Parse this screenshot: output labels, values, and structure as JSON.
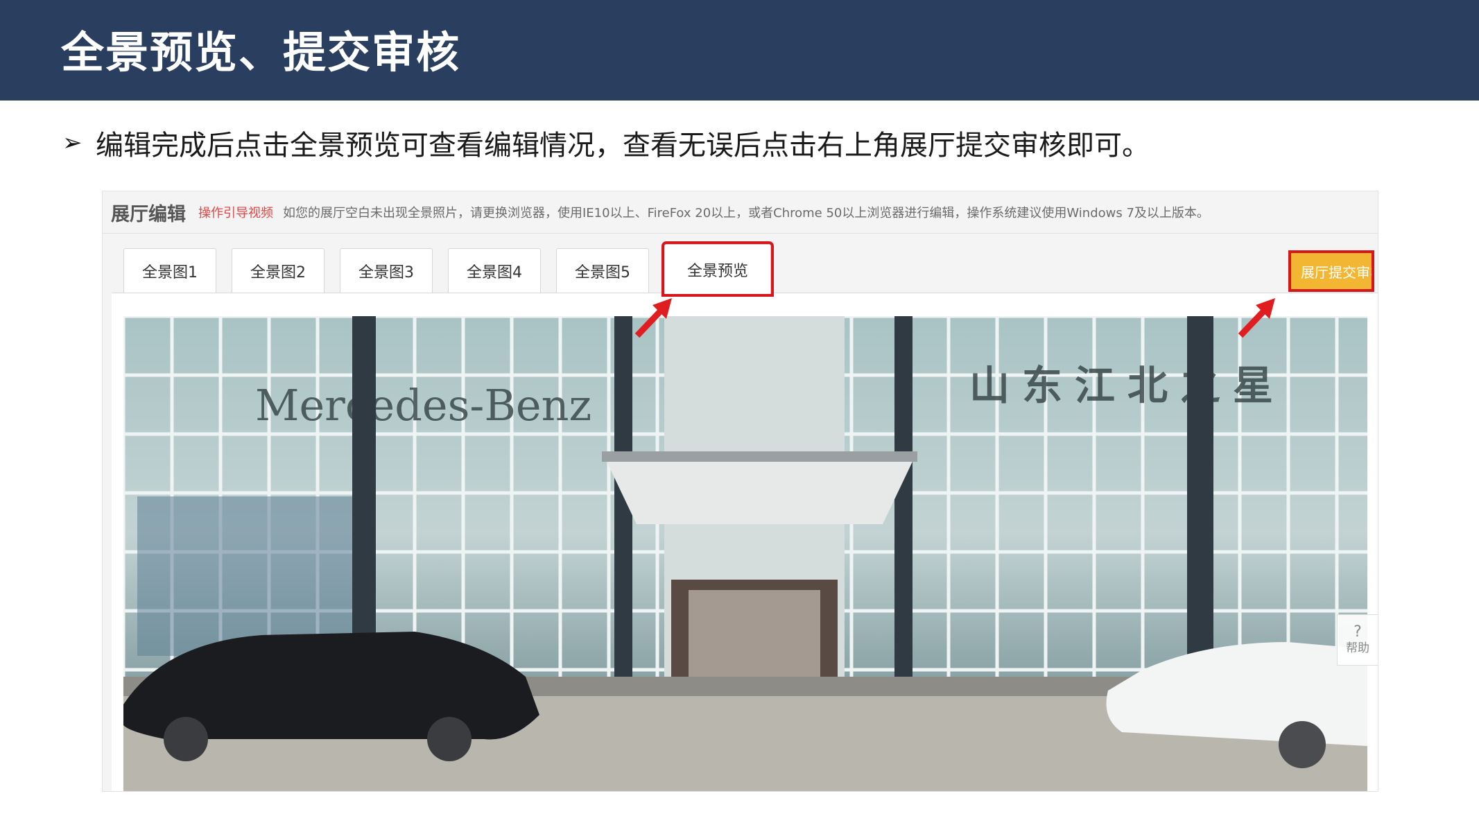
{
  "slide": {
    "title": "全景预览、提交审核",
    "instruction": "编辑完成后点击全景预览可查看编辑情况，查看无误后点击右上角展厅提交审核即可。",
    "bullet_icon": "arrow-bullet-icon"
  },
  "editor": {
    "title": "展厅编辑",
    "guide_link": "操作引导视频",
    "notice": "如您的展厅空白未出现全景照片，请更换浏览器，使用IE10以上、FireFox 20以上，或者Chrome 50以上浏览器进行编辑，操作系统建议使用Windows 7及以上版本。",
    "tabs": [
      {
        "label": "全景图1",
        "active": false
      },
      {
        "label": "全景图2",
        "active": false
      },
      {
        "label": "全景图3",
        "active": false
      },
      {
        "label": "全景图4",
        "active": false
      },
      {
        "label": "全景图5",
        "active": false
      },
      {
        "label": "全景预览",
        "active": true
      }
    ],
    "submit_button": "展厅提交审核",
    "help": {
      "icon": "?",
      "label": "帮助"
    }
  },
  "photo": {
    "sign_left": "Mercedes-Benz",
    "sign_right": "山东江北之星"
  },
  "colors": {
    "header": "#2a3f5f",
    "highlight": "#d7161c",
    "submit": "#f2b632"
  }
}
